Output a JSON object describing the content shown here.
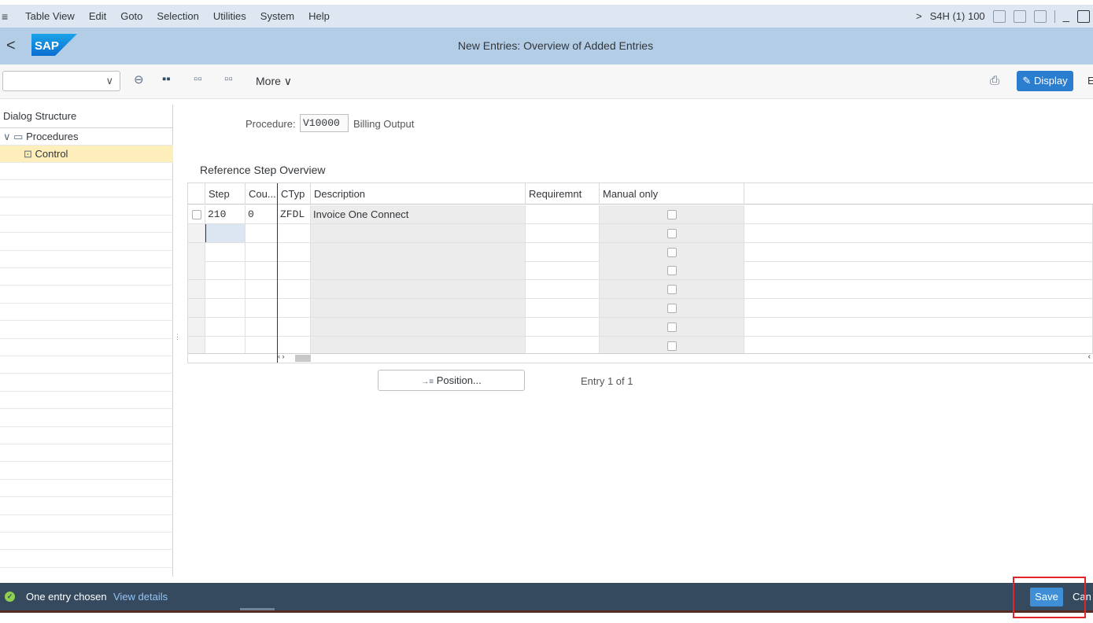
{
  "menubar": {
    "hamburger": "≡",
    "items": [
      "Table View",
      "Edit",
      "Goto",
      "Selection",
      "Utilities",
      "System",
      "Help"
    ],
    "system_id": "S4H (1) 100",
    "more": ">"
  },
  "titlebar": {
    "back": "<",
    "logo_text": "SAP",
    "title": "New Entries: Overview of Added Entries"
  },
  "toolbar": {
    "select_value": "",
    "more_label": "More ∨",
    "display_label": "Display",
    "overflow_label": "E"
  },
  "dialog": {
    "header": "Dialog Structure",
    "items": [
      {
        "label": "Procedures",
        "expanded": true
      },
      {
        "label": "Control",
        "selected": true
      }
    ]
  },
  "procedure": {
    "label": "Procedure:",
    "value": "V10000",
    "text": "Billing Output"
  },
  "overview": {
    "title": "Reference Step Overview",
    "columns": [
      "Step",
      "Cou...",
      "CTyp",
      "Description",
      "Requiremnt",
      "Manual only"
    ],
    "rows": [
      {
        "step": "210",
        "counter": "0",
        "ctyp": "ZFDL",
        "description": "Invoice One Connect",
        "requirement": "",
        "manual_only": false
      }
    ],
    "empty_rows": 7,
    "position_button": "Position...",
    "entry_text": "Entry 1 of 1",
    "scroll_marks": "‹ ›"
  },
  "status": {
    "message": "One entry chosen",
    "details_link": "View details",
    "save_label": "Save",
    "cancel_label": "Can"
  }
}
